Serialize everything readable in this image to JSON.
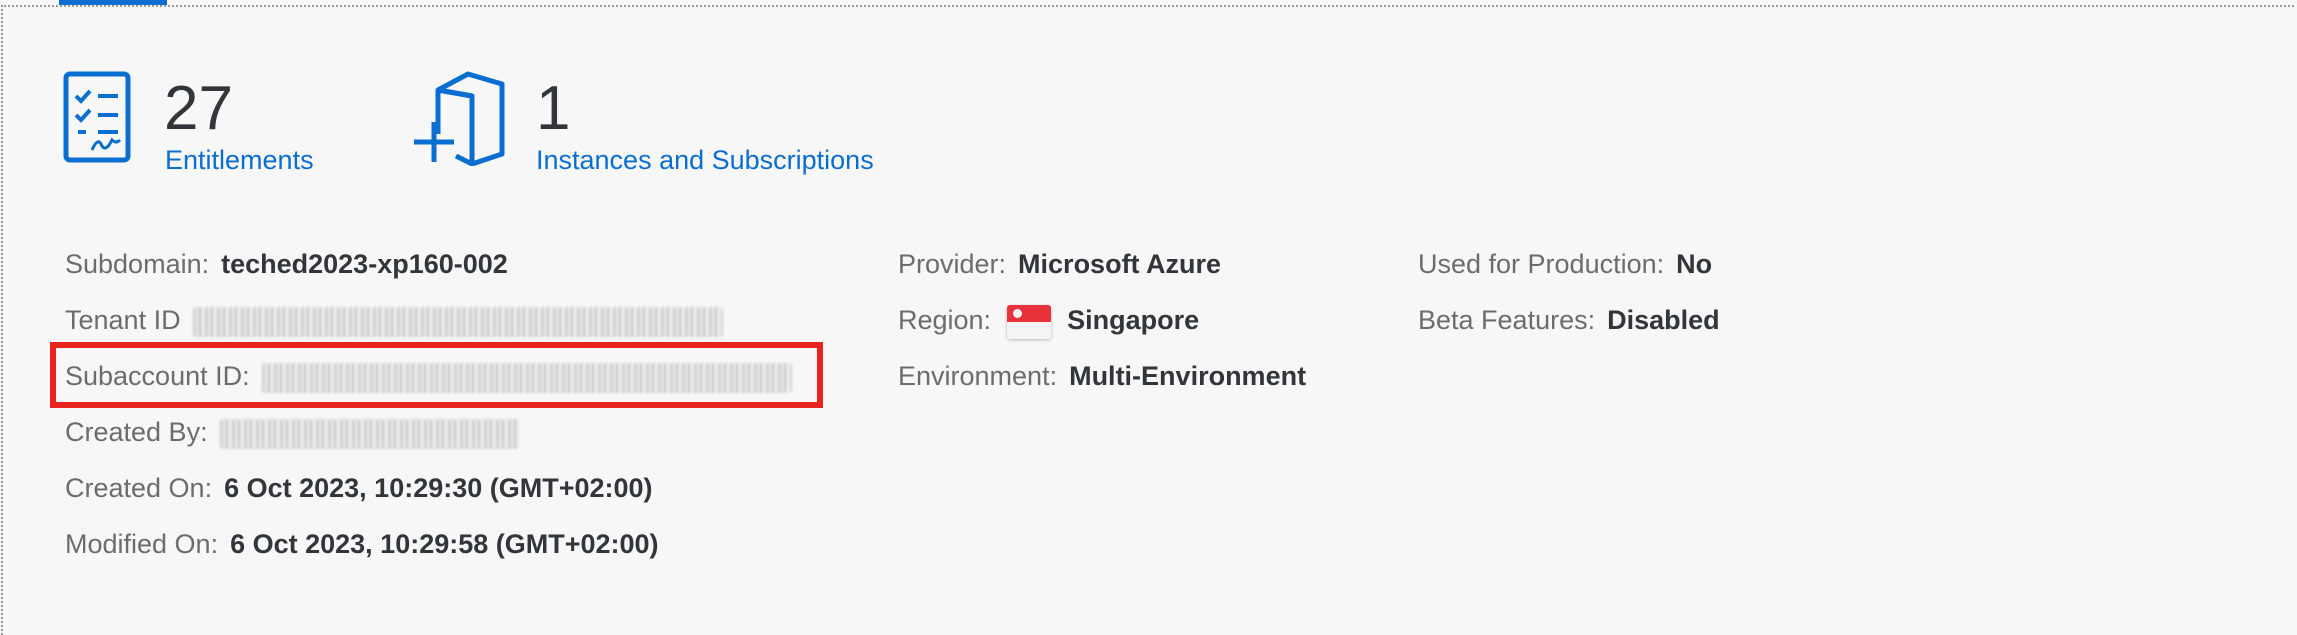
{
  "kpis": {
    "entitlements": {
      "count": "27",
      "label": "Entitlements",
      "icon": "checklist-icon"
    },
    "instances": {
      "count": "1",
      "label": "Instances and Subscriptions",
      "icon": "add-documents-icon"
    }
  },
  "details": {
    "subdomain": {
      "label": "Subdomain:",
      "value": "teched2023-xp160-002"
    },
    "tenant_id": {
      "label": "Tenant ID"
    },
    "subaccount_id": {
      "label": "Subaccount ID:"
    },
    "created_by": {
      "label": "Created By:"
    },
    "created_on": {
      "label": "Created On:",
      "value": "6 Oct 2023, 10:29:30 (GMT+02:00)"
    },
    "modified_on": {
      "label": "Modified On:",
      "value": "6 Oct 2023, 10:29:58 (GMT+02:00)"
    },
    "provider": {
      "label": "Provider:",
      "value": "Microsoft Azure"
    },
    "region": {
      "label": "Region:",
      "value": "Singapore",
      "flag": "singapore-flag-icon"
    },
    "environment": {
      "label": "Environment:",
      "value": "Multi-Environment"
    },
    "used_for_production": {
      "label": "Used for Production:",
      "value": "No"
    },
    "beta_features": {
      "label": "Beta Features:",
      "value": "Disabled"
    }
  },
  "colors": {
    "link": "#0a6ed1",
    "highlight": "#e8221d",
    "text": "#32363a",
    "label": "#6a6d70"
  }
}
